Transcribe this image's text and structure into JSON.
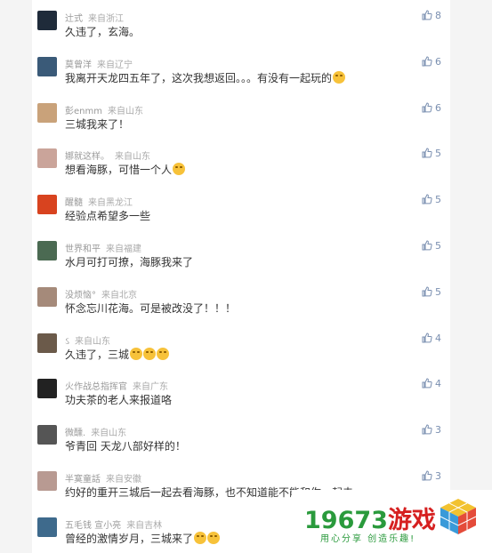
{
  "comments": [
    {
      "user": "辻式",
      "source": "来自浙江",
      "text": "久违了，玄海。",
      "likes": "8",
      "avatar_color": "#1f2b3a",
      "emojis": 0
    },
    {
      "user": "莫曾洋",
      "source": "来自辽宁",
      "text": "我离开天龙四五年了，这次我想返回。。。有没有一起玩的",
      "likes": "6",
      "avatar_color": "#3a5a78",
      "emojis": 1
    },
    {
      "user": "彭enmm",
      "source": "来自山东",
      "text": "三城我来了！",
      "likes": "6",
      "avatar_color": "#c9a27a",
      "emojis": 0
    },
    {
      "user": "娜就这样。",
      "source": "来自山东",
      "text": "想看海豚，可惜一个人",
      "likes": "5",
      "avatar_color": "#caa49a",
      "emojis": 1
    },
    {
      "user": "醒髓",
      "source": "来自黑龙江",
      "text": "经验点希望多一些",
      "likes": "5",
      "avatar_color": "#d8431f",
      "emojis": 0
    },
    {
      "user": "世界和平",
      "source": "来自福建",
      "text": "水月可打可撩，海豚我来了",
      "likes": "5",
      "avatar_color": "#4b6a52",
      "emojis": 0
    },
    {
      "user": "没烦恼°",
      "source": "来自北京",
      "text": "怀念忘川花海。可是被改没了！！！",
      "likes": "5",
      "avatar_color": "#a58a7a",
      "emojis": 0
    },
    {
      "user": "ઽ",
      "source": "来自山东",
      "text": "久违了，三城",
      "likes": "4",
      "avatar_color": "#6b5a4a",
      "emojis": 3
    },
    {
      "user": "火作战总指挥官",
      "source": "来自广东",
      "text": "功夫茶的老人来报道咯",
      "likes": "4",
      "avatar_color": "#222222",
      "emojis": 0
    },
    {
      "user": "微醺.",
      "source": "来自山东",
      "text": "爷青回 天龙八部好样的！",
      "likes": "3",
      "avatar_color": "#555555",
      "emojis": 0
    },
    {
      "user": "半寞童話",
      "source": "来自安徽",
      "text": "约好的重开三城后一起去看海豚，也不知道能不能和你一起去",
      "likes": "3",
      "avatar_color": "#b89a92",
      "emojis": 0
    },
    {
      "user": "五毛钱 宣小亮",
      "source": "来自吉林",
      "text": "曾经的激情岁月，三城来了",
      "likes": "",
      "avatar_color": "#3e6a8c",
      "emojis": 2
    }
  ],
  "watermark": {
    "brand_number": "19673",
    "brand_word": "游戏",
    "slogan": "用心分享 创造乐趣!"
  }
}
